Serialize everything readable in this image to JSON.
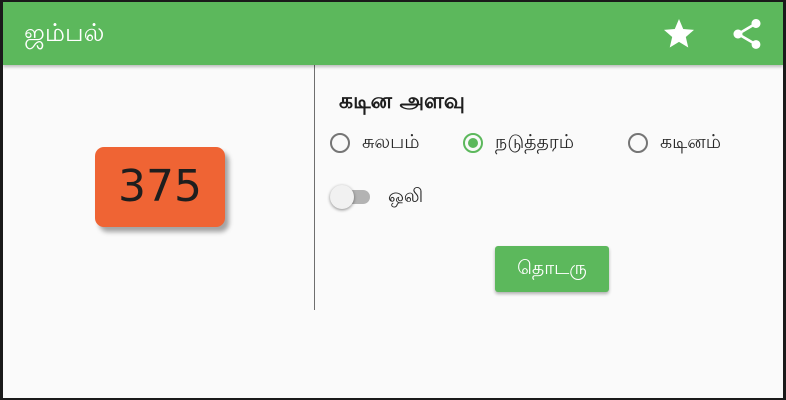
{
  "app": {
    "title": "ஜம்பல்",
    "accent_color": "#5cb85c",
    "actions": [
      {
        "icon": "star-icon"
      },
      {
        "icon": "share-icon"
      }
    ]
  },
  "score": {
    "value": "375",
    "color": "#ef6434"
  },
  "difficulty": {
    "title": "கடின அளவு",
    "options": [
      {
        "label": "சுலபம்",
        "checked": false
      },
      {
        "label": "நடுத்தரம்",
        "checked": true
      },
      {
        "label": "கடினம்",
        "checked": false
      }
    ]
  },
  "sound": {
    "label": "ஒலி",
    "enabled": false
  },
  "continue_label": "தொடரு"
}
